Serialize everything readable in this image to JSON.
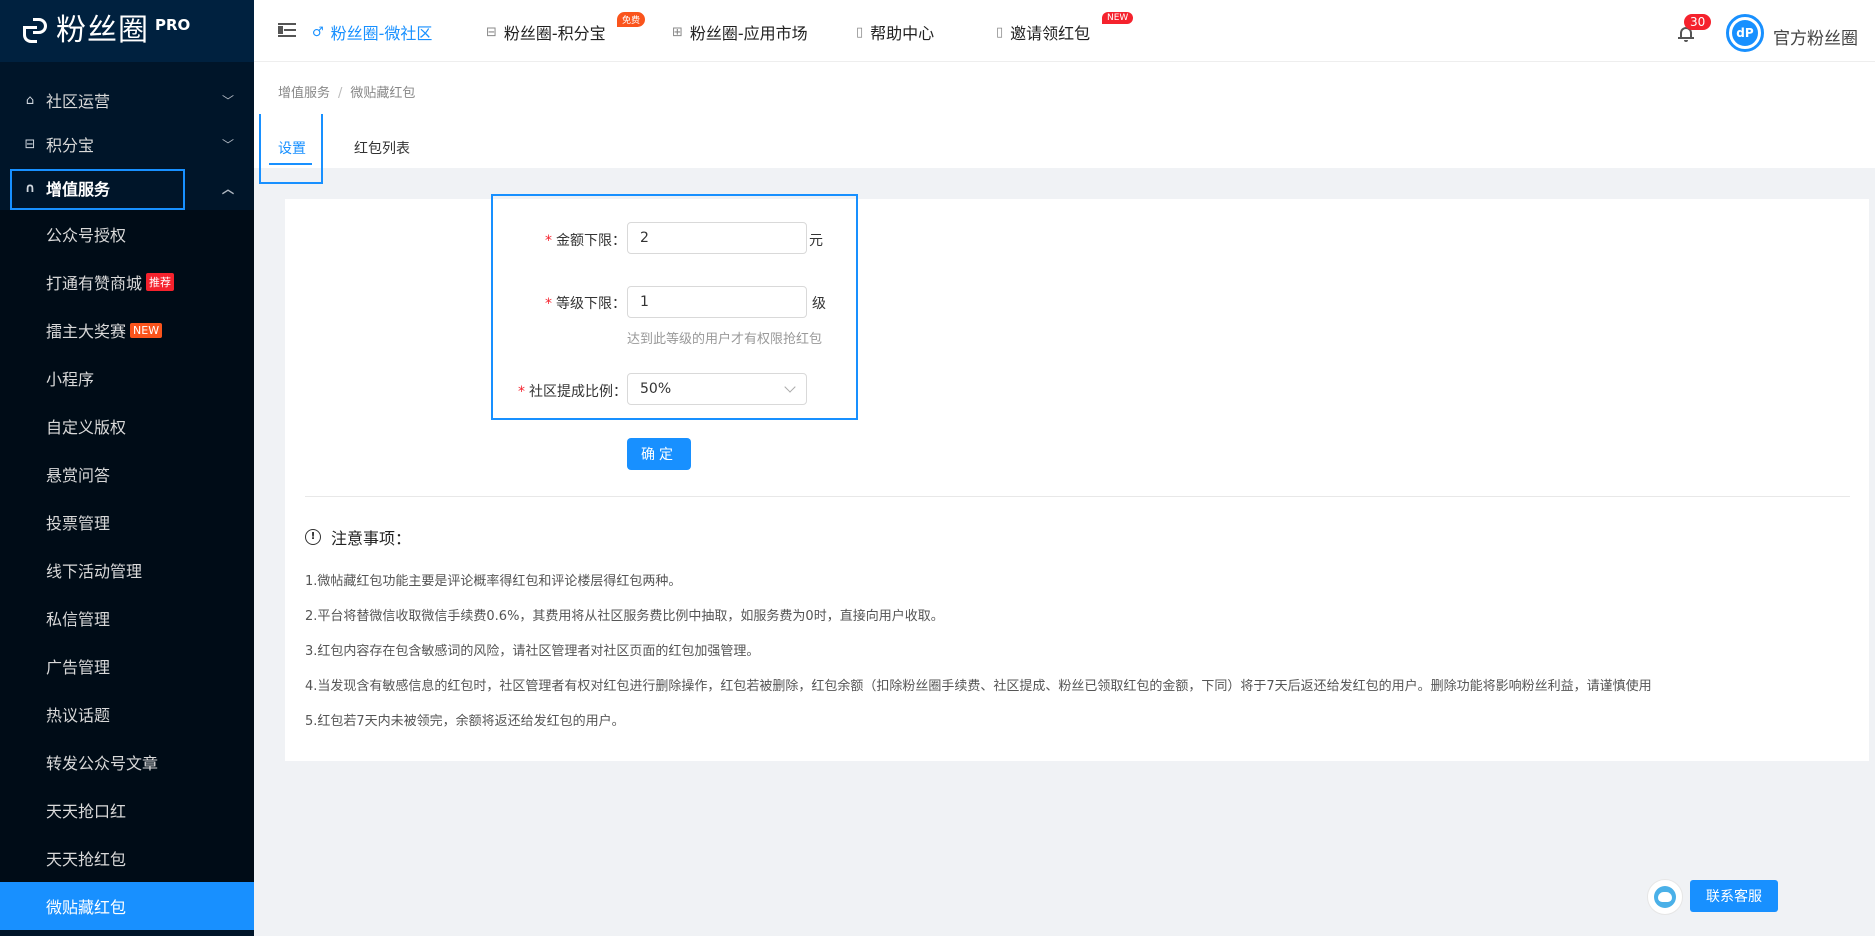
{
  "brand": {
    "name": "粉丝圈",
    "suffix": "PRO"
  },
  "sidebar": {
    "groups": [
      {
        "label": "社区运营",
        "icon": "home-icon"
      },
      {
        "label": "积分宝",
        "icon": "gift-icon"
      },
      {
        "label": "增值服务",
        "icon": "headset-icon"
      }
    ],
    "items": [
      {
        "label": "公众号授权",
        "tag": ""
      },
      {
        "label": "打通有赞商城",
        "tag": "推荐"
      },
      {
        "label": "擂主大奖赛",
        "tag": "NEW"
      },
      {
        "label": "小程序",
        "tag": ""
      },
      {
        "label": "自定义版权",
        "tag": ""
      },
      {
        "label": "悬赏问答",
        "tag": ""
      },
      {
        "label": "投票管理",
        "tag": ""
      },
      {
        "label": "线下活动管理",
        "tag": ""
      },
      {
        "label": "私信管理",
        "tag": ""
      },
      {
        "label": "广告管理",
        "tag": ""
      },
      {
        "label": "热议话题",
        "tag": ""
      },
      {
        "label": "转发公众号文章",
        "tag": ""
      },
      {
        "label": "天天抢口红",
        "tag": ""
      },
      {
        "label": "天天抢红包",
        "tag": ""
      },
      {
        "label": "微贴藏红包",
        "tag": ""
      }
    ]
  },
  "header": {
    "nav": [
      {
        "label": "粉丝圈-微社区",
        "badge": ""
      },
      {
        "label": "粉丝圈-积分宝",
        "badge": "免费"
      },
      {
        "label": "粉丝圈-应用市场",
        "badge": ""
      },
      {
        "label": "帮助中心",
        "badge": ""
      },
      {
        "label": "邀请领红包",
        "badge": "NEW"
      }
    ],
    "notification_count": "30",
    "avatar_text": "dP",
    "user_name": "官方粉丝圈"
  },
  "breadcrumb": {
    "parent": "增值服务",
    "separator": "/",
    "current": "微贴藏红包"
  },
  "tabs": [
    {
      "label": "设置"
    },
    {
      "label": "红包列表"
    }
  ],
  "form": {
    "amount_label": "金额下限：",
    "amount_value": "2",
    "amount_unit": "元",
    "level_label": "等级下限：",
    "level_value": "1",
    "level_unit": "级",
    "level_hint": "达到此等级的用户才有权限抢红包",
    "ratio_label": "社区提成比例：",
    "ratio_value": "50%",
    "required_mark": "*",
    "submit_label": "确定"
  },
  "notice": {
    "title": "注意事项：",
    "items": [
      "1.微帖藏红包功能主要是评论概率得红包和评论楼层得红包两种。",
      "2.平台将替微信收取微信手续费0.6%，其费用将从社区服务费比例中抽取，如服务费为0时，直接向用户收取。",
      "3.红包内容存在包含敏感词的风险，请社区管理者对社区页面的红包加强管理。",
      "4.当发现含有敏感信息的红包时，社区管理者有权对红包进行删除操作，红包若被删除，红包余额（扣除粉丝圈手续费、社区提成、粉丝已领取红包的金额，下同）将于7天后返还给发红包的用户。删除功能将影响粉丝利益，请谨慎使用",
      "5.红包若7天内未被领完，余额将返还给发红包的用户。"
    ]
  },
  "support": {
    "contact_label": "联系客服"
  },
  "colors": {
    "primary": "#1890ff",
    "sidebar_bg": "#001529",
    "danger": "#f5222d"
  }
}
